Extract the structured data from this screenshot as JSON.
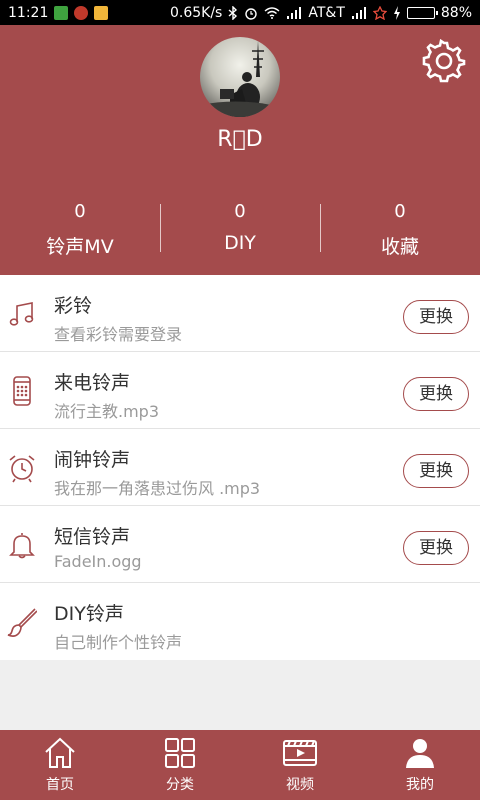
{
  "status_bar": {
    "time": "11:21",
    "speed": "0.65K/s",
    "carrier": "AT&T",
    "battery": "88%",
    "battery_level": 0.88
  },
  "profile": {
    "username": "R\u0000D",
    "stats": [
      {
        "value": "0",
        "label": "铃声MV"
      },
      {
        "value": "0",
        "label": "DIY"
      },
      {
        "value": "0",
        "label": "收藏"
      }
    ]
  },
  "list": [
    {
      "title": "彩铃",
      "subtitle": "查看彩铃需要登录",
      "button": "更换",
      "icon": "music-note-icon"
    },
    {
      "title": "来电铃声",
      "subtitle": "流行主教.mp3",
      "button": "更换",
      "icon": "phone-icon"
    },
    {
      "title": "闹钟铃声",
      "subtitle": "我在那一角落患过伤风 .mp3",
      "button": "更换",
      "icon": "alarm-clock-icon"
    },
    {
      "title": "短信铃声",
      "subtitle": "FadeIn.ogg",
      "button": "更换",
      "icon": "bell-icon"
    },
    {
      "title": "DIY铃声",
      "subtitle": "自己制作个性铃声",
      "icon": "brush-icon"
    }
  ],
  "nav": [
    {
      "label": "首页",
      "icon": "home-icon"
    },
    {
      "label": "分类",
      "icon": "grid-icon"
    },
    {
      "label": "视频",
      "icon": "video-icon"
    },
    {
      "label": "我的",
      "icon": "user-icon"
    }
  ],
  "colors": {
    "brand": "#a44b4c",
    "battery": "#6cd36c"
  }
}
